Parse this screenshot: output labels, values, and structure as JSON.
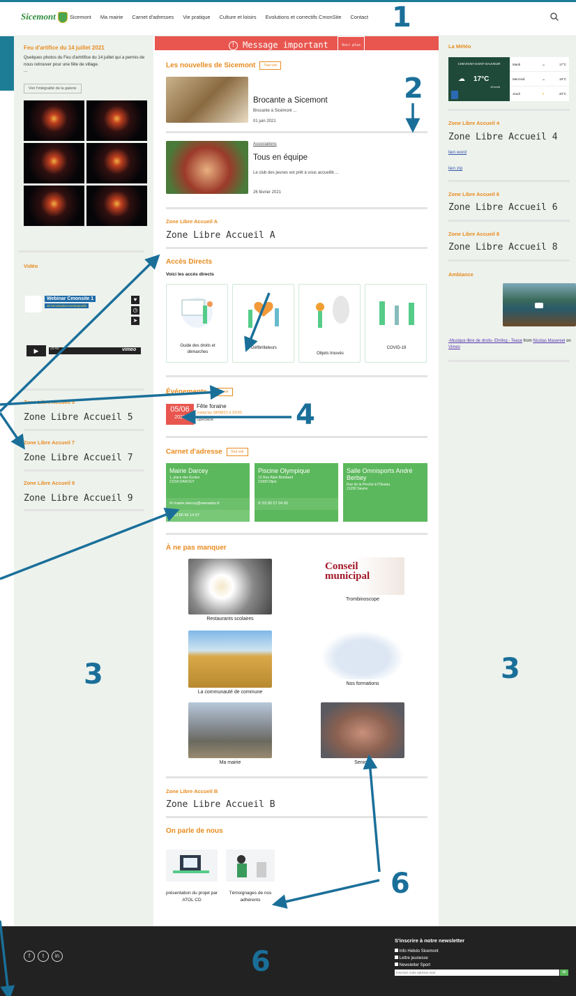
{
  "nav": {
    "logo": "Sicemont",
    "items": [
      "Sicemont",
      "Ma mairie",
      "Carnet d'adresses",
      "Vie pratique",
      "Culture et loisirs",
      "Evolutions et correctifs CmonSite",
      "Contact"
    ]
  },
  "annotations": [
    "1",
    "2",
    "3",
    "3",
    "4",
    "6",
    "6"
  ],
  "left": {
    "feu_title": "Feu d'artifice du 14 juillet 2021",
    "feu_text": "Quelques photos du Feu d'artrtifice du 14 juillet qui a permis de nous retrouver pour une fête de village.",
    "feu_ellipsis": "...",
    "feu_btn": "Voir l'intégralité de la galerie",
    "video_title": "Vidéo",
    "video_name": "Webinar Cmonsite 1",
    "video_sub": "de benclaudecmonsitejeudi6",
    "video_time": "25:45",
    "vimeo": "vimeo",
    "zone5": "Zone Libre Accueil 5",
    "zone7": "Zone Libre Accueil 7",
    "zone9": "Zone Libre Accueil 9"
  },
  "center": {
    "msg": "Message important",
    "msg_btn": "Voir plus",
    "news_title": "Les nouvelles de Sicemont",
    "tout_voir": "Tout voir",
    "news": [
      {
        "title": "Brocante a Sicemont",
        "sub": "Brocante à Sicémont ...",
        "date": "01 juin 2021",
        "cat": ""
      },
      {
        "title": "Tous en équipe",
        "sub": "Le club des jeunes est prêt à vous accueillir....",
        "date": "26 février 2021",
        "cat": "Associations"
      }
    ],
    "zoneA_label": "Zone Libre Accueil A",
    "zoneA": "Zone Libre Accueil A",
    "acces_title": "Accès Directs",
    "acces_sub": "Voici les accès directs",
    "acces": [
      "Guide des droits et démarches",
      "Défibrillateurs",
      "Objets trouvés",
      "COVID-19"
    ],
    "events_title": "Événements",
    "event": {
      "day": "05/06",
      "year": "2021",
      "title": "Fête foraine",
      "when": "Jusqu'au 18/08/21 à 23:00",
      "type": "Spectacle"
    },
    "carnet_title": "Carnet d'adresse",
    "carnet": [
      {
        "name": "Mairie Darcey",
        "addr1": "1, place des Écoles",
        "addr2": "21150 DARCEY",
        "mail": "mairie.darcey@wanadoo.fr",
        "tel": "03 80 96 14 07"
      },
      {
        "name": "Piscine Olympique",
        "addr1": "12 Rue Alain Bombard",
        "addr2": "21000 Dijon",
        "tel": "03 80 27 04 60"
      },
      {
        "name": "Salle Omnisports André Berbey",
        "addr1": "Rue de la Perche à l'Oiseau",
        "addr2": "21250 Seurre"
      }
    ],
    "nepas_title": "À ne pas manquer",
    "nepas": [
      "Restaurants scolaires",
      "Trombinoscope",
      "La communauté de commune",
      "Nos formations",
      "Ma mairie",
      "Seniors"
    ],
    "conseil": "Conseil municipal",
    "zoneB_label": "Zone Libre Accueil B",
    "zoneB": "Zone Libre Accueil B",
    "parle_title": "On parle de nous",
    "parle": [
      "présentation du projet par ATOL CD",
      "Témoignages de nos adhérents"
    ]
  },
  "right": {
    "meteo_title": "La Météo",
    "meteo_city": "CHEVIGNY-SAINT-SAUVEUR",
    "meteo_temp": "17°C",
    "meteo_wind": "15 km/h",
    "meteo_days": [
      {
        "d": "Mardi",
        "t": "17°C"
      },
      {
        "d": "Mercredi",
        "t": "19°C"
      },
      {
        "d": "Jeudi",
        "t": "20°C"
      }
    ],
    "zone4_label": "Zone Libre Accueil 4",
    "zone4": "Zone Libre Accueil 4",
    "lien_word": "lien word",
    "lien_zip": "lien zip",
    "zone6_label": "Zone Libre Accueil 6",
    "zone6": "Zone Libre Accueil 6",
    "zone8_label": "Zone Libre Accueil 8",
    "zone8": "Zone Libre Accueil 8",
    "ambiance_title": "Ambiance",
    "ambiance_caption": "-Musique libre de droits- Ehrling - Tease",
    "from": " from ",
    "author": "Nicolas Masereel",
    "on": " on ",
    "vimeo": "Vimeo"
  },
  "footer": {
    "newsletter_title": "S'inscrire à notre newsletter",
    "options": [
      "Info Hebdo Sicemont",
      "Lettre jeunesse",
      "Newsletter Sport"
    ],
    "placeholder": "Inscrivez votre adresse mail",
    "ok": "ok",
    "social": [
      "f",
      "t",
      "in"
    ]
  },
  "colors": {
    "accent": "#e88b1f",
    "green": "#5cb85c",
    "red": "#e8564f",
    "annot": "#1a6f99"
  }
}
